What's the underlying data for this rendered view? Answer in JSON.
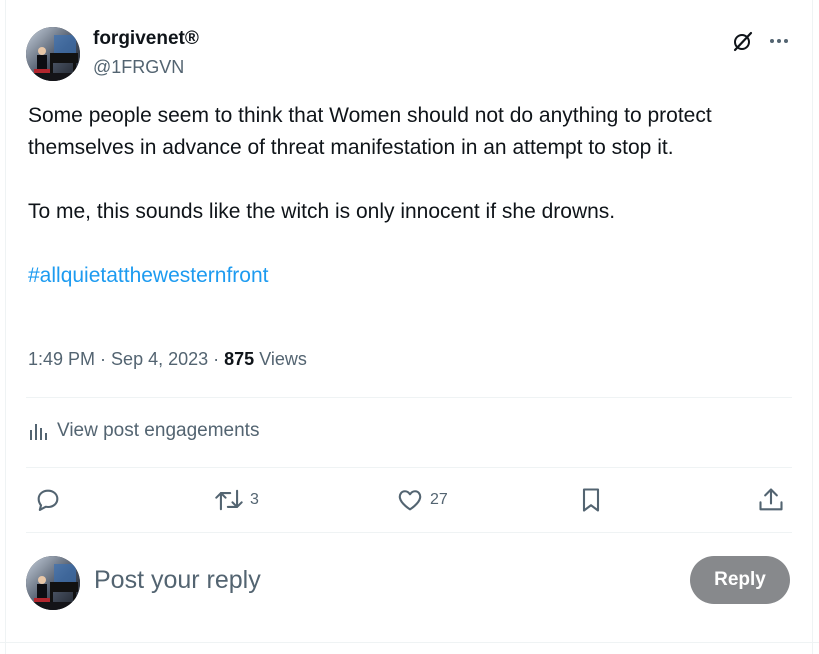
{
  "author": {
    "display_name": "forgivenet®",
    "handle": "@1FRGVN",
    "avatar_icon": "pianist-avatar-icon"
  },
  "header_icons": {
    "grok": "grok-icon",
    "more": "more-icon"
  },
  "post": {
    "paragraph1": "Some people seem to think that Women should not do anything to protect themselves in advance of threat manifestation in an attempt to stop it.",
    "paragraph2": "To me, this sounds like the witch is only innocent if she drowns.",
    "hashtag": "#allquietatthewesternfront"
  },
  "meta": {
    "time": "1:49 PM",
    "separator1": " · ",
    "date": "Sep 4, 2023",
    "separator2": " · ",
    "views_count": "875",
    "views_label": " Views"
  },
  "engagements": {
    "label": "View post engagements",
    "icon": "analytics-icon"
  },
  "actions": {
    "reply": {
      "icon": "reply-icon",
      "count": ""
    },
    "repost": {
      "icon": "repost-icon",
      "count": "3"
    },
    "like": {
      "icon": "like-icon",
      "count": "27"
    },
    "bookmark": {
      "icon": "bookmark-icon",
      "count": ""
    },
    "share": {
      "icon": "share-icon",
      "count": ""
    }
  },
  "reply_box": {
    "placeholder": "Post your reply",
    "button_label": "Reply"
  },
  "colors": {
    "text": "#0f1419",
    "secondary": "#536471",
    "link": "#1d9bf0",
    "divider": "#eff3f4",
    "reply_button": "#87898c"
  }
}
